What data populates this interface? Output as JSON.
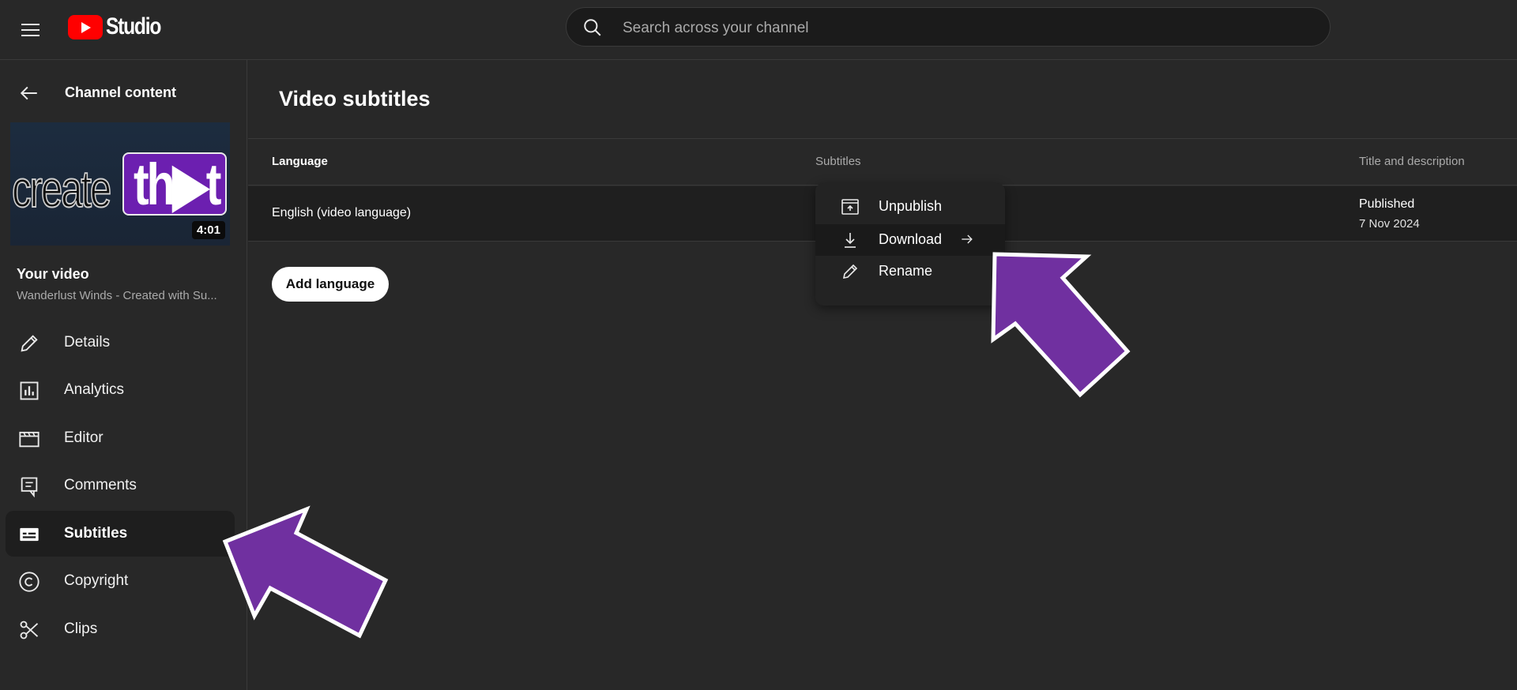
{
  "header": {
    "logo_text": "Studio",
    "search_placeholder": "Search across your channel"
  },
  "sidebar": {
    "back_label": "Channel content",
    "thumbnail": {
      "word_left": "create",
      "word_right": "th▶t",
      "duration": "4:01",
      "brand_color": "#6c1fb0"
    },
    "your_video_label": "Your video",
    "video_title": "Wanderlust Winds - Created with Su...",
    "items": [
      {
        "label": "Details",
        "icon": "pencil-icon"
      },
      {
        "label": "Analytics",
        "icon": "analytics-icon"
      },
      {
        "label": "Editor",
        "icon": "clapperboard-icon"
      },
      {
        "label": "Comments",
        "icon": "comment-icon"
      },
      {
        "label": "Subtitles",
        "icon": "subtitles-icon",
        "active": true
      },
      {
        "label": "Copyright",
        "icon": "copyright-icon"
      },
      {
        "label": "Clips",
        "icon": "scissors-icon"
      }
    ]
  },
  "main": {
    "title": "Video subtitles",
    "columns": [
      "Language",
      "Subtitles",
      "Title and description"
    ],
    "rows": [
      {
        "language": "English (video language)",
        "status": "Published",
        "date": "7 Nov 2024"
      }
    ],
    "add_language_label": "Add language"
  },
  "menu": {
    "items": [
      {
        "label": "Unpublish",
        "icon": "unpublish-icon"
      },
      {
        "label": "Download",
        "icon": "download-icon",
        "highlighted": true
      },
      {
        "label": "Rename",
        "icon": "pencil-icon"
      }
    ]
  },
  "colors": {
    "background": "#282828",
    "annotation_arrow": "#7030a0",
    "youtube_red": "#ff0000"
  }
}
